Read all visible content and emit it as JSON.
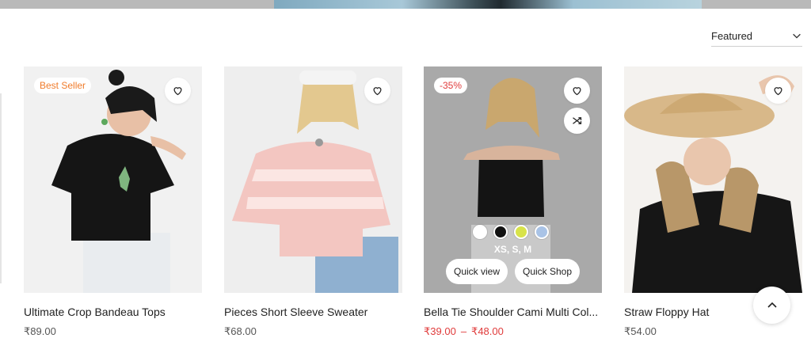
{
  "sort": {
    "selected": "Featured"
  },
  "products": [
    {
      "title": "Ultimate Crop Bandeau Tops",
      "price": "₹89.00",
      "badge": "Best Seller"
    },
    {
      "title": "Pieces Short Sleeve Sweater",
      "price": "₹68.00"
    },
    {
      "title": "Bella Tie Shoulder Cami Multi Col...",
      "price_from": "₹39.00",
      "price_sep": "–",
      "price_to": "₹48.00",
      "badge": "-35%",
      "sizes": "XS, S, M",
      "quick_view_label": "Quick view",
      "quick_shop_label": "Quick Shop",
      "swatch_colors": [
        "#ffffff",
        "#111111",
        "#d8e34a",
        "#a9c3e6"
      ]
    },
    {
      "title": "Straw Floppy Hat",
      "price": "₹54.00"
    }
  ],
  "icons": {
    "wishlist": "heart-icon",
    "compare": "shuffle-icon",
    "sort": "chevron-down-icon",
    "back_to_top": "chevron-up-icon"
  },
  "colors": {
    "sale": "#e03b3b",
    "best_seller": "#f07b2a"
  }
}
